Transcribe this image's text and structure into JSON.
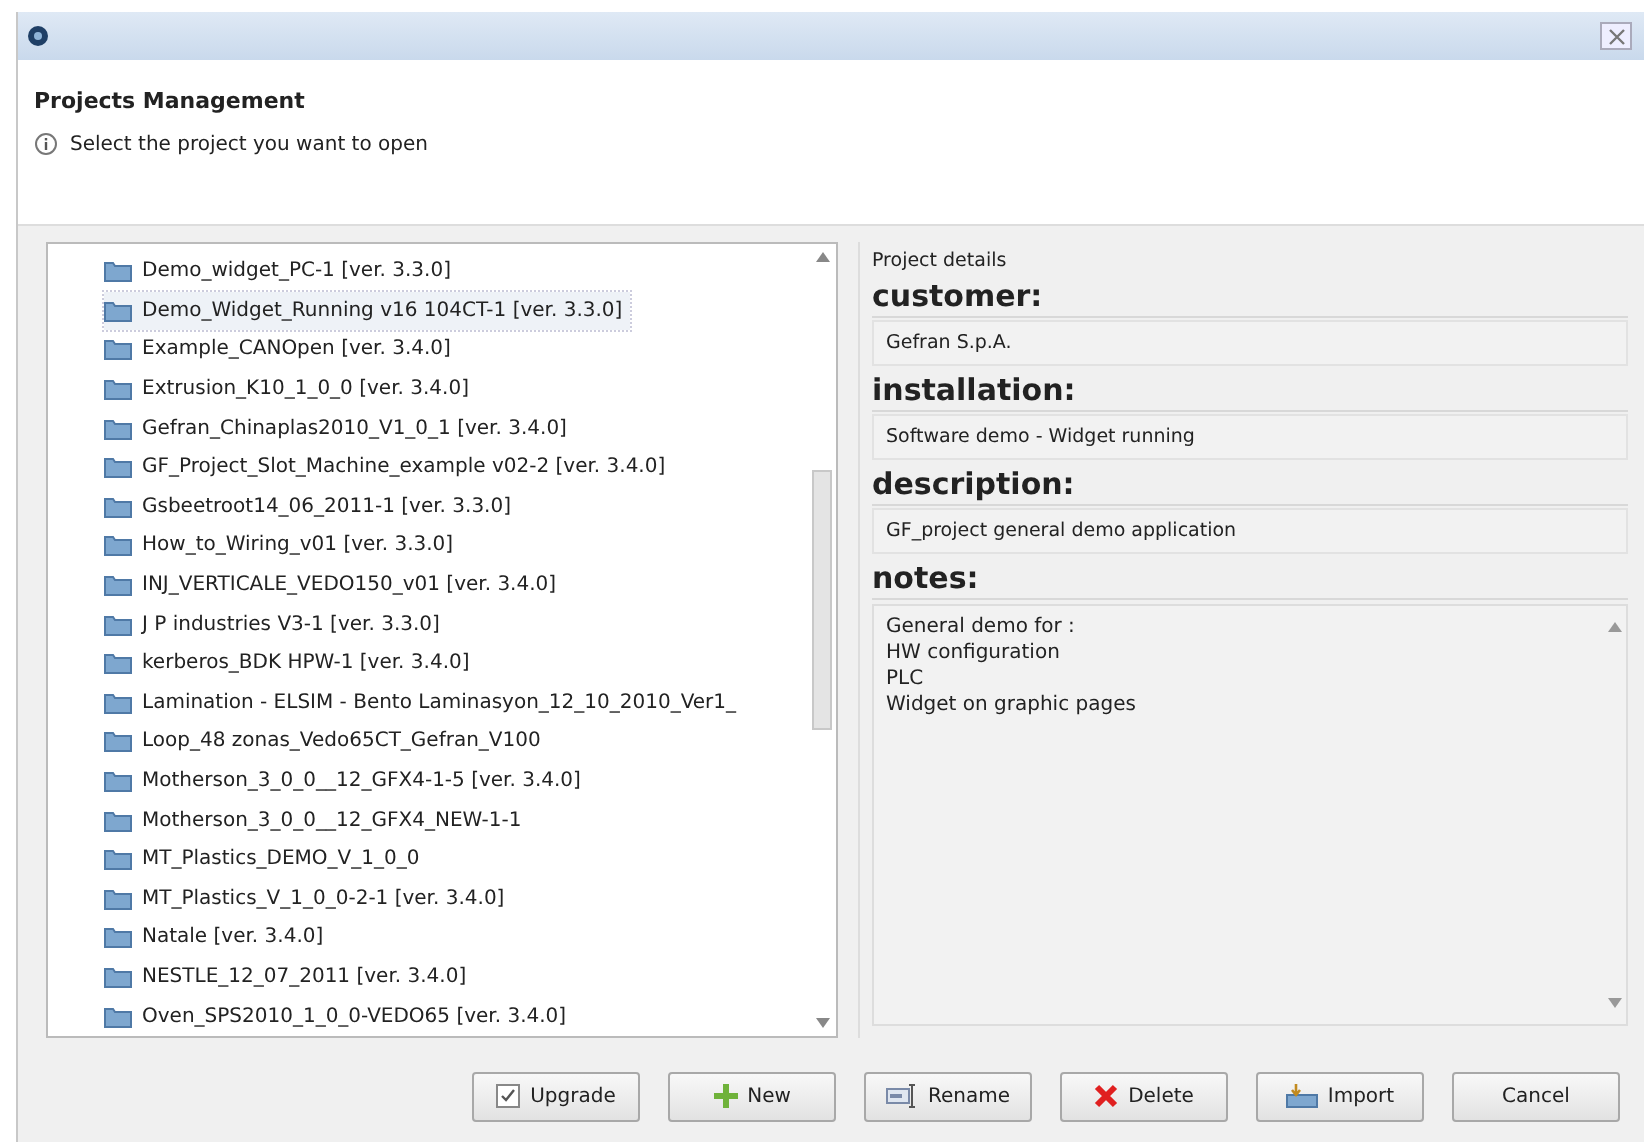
{
  "header": {
    "title": "Projects Management",
    "message": "Select the project you want to open"
  },
  "projects": [
    {
      "name": "Demo_widget_PC-1 [ver. 3.3.0]",
      "selected": false
    },
    {
      "name": "Demo_Widget_Running v16 104CT-1 [ver. 3.3.0]",
      "selected": true
    },
    {
      "name": "Example_CANOpen [ver. 3.4.0]",
      "selected": false
    },
    {
      "name": "Extrusion_K10_1_0_0 [ver. 3.4.0]",
      "selected": false
    },
    {
      "name": "Gefran_Chinaplas2010_V1_0_1 [ver. 3.4.0]",
      "selected": false
    },
    {
      "name": "GF_Project_Slot_Machine_example v02-2 [ver. 3.4.0]",
      "selected": false
    },
    {
      "name": "Gsbeetroot14_06_2011-1 [ver. 3.3.0]",
      "selected": false
    },
    {
      "name": "How_to_Wiring_v01 [ver. 3.3.0]",
      "selected": false
    },
    {
      "name": "INJ_VERTICALE_VEDO150_v01 [ver. 3.4.0]",
      "selected": false
    },
    {
      "name": "J P industries V3-1 [ver. 3.3.0]",
      "selected": false
    },
    {
      "name": "kerberos_BDK HPW-1 [ver. 3.4.0]",
      "selected": false
    },
    {
      "name": "Lamination - ELSIM - Bento Laminasyon_12_10_2010_Ver1_",
      "selected": false
    },
    {
      "name": "Loop_48 zonas_Vedo65CT_Gefran_V100",
      "selected": false
    },
    {
      "name": "Motherson_3_0_0__12_GFX4-1-5 [ver. 3.4.0]",
      "selected": false
    },
    {
      "name": "Motherson_3_0_0__12_GFX4_NEW-1-1",
      "selected": false
    },
    {
      "name": "MT_Plastics_DEMO_V_1_0_0",
      "selected": false
    },
    {
      "name": "MT_Plastics_V_1_0_0-2-1 [ver. 3.4.0]",
      "selected": false
    },
    {
      "name": "Natale [ver. 3.4.0]",
      "selected": false
    },
    {
      "name": "NESTLE_12_07_2011 [ver. 3.4.0]",
      "selected": false
    },
    {
      "name": "Oven_SPS2010_1_0_0-VEDO65 [ver. 3.4.0]",
      "selected": false
    }
  ],
  "details": {
    "title": "Project details",
    "fields": [
      {
        "label": "customer:",
        "kind": "line",
        "value": "Gefran S.p.A."
      },
      {
        "label": "installation:",
        "kind": "line",
        "value": "Software demo - Widget running"
      },
      {
        "label": "description:",
        "kind": "line",
        "value": "GF_project general demo application"
      },
      {
        "label": "notes:",
        "kind": "area",
        "lines": [
          "General demo for :",
          "HW configuration",
          "PLC",
          "Widget on graphic pages"
        ]
      }
    ]
  },
  "buttons": [
    {
      "label": "Upgrade",
      "kind": "upgrade"
    },
    {
      "label": "New",
      "kind": "new"
    },
    {
      "label": "Rename",
      "kind": "rename"
    },
    {
      "label": "Delete",
      "kind": "delete"
    },
    {
      "label": "Import",
      "kind": "import"
    },
    {
      "label": "Cancel",
      "kind": "cancel"
    }
  ]
}
